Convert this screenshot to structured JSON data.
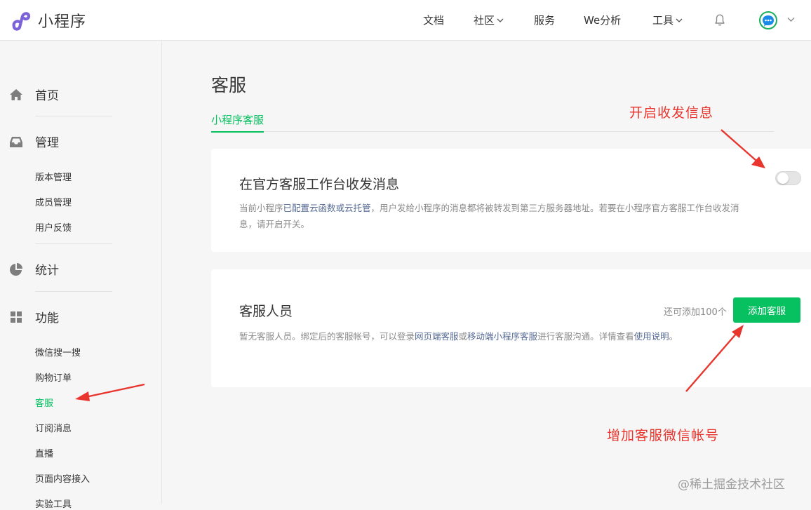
{
  "app": {
    "name": "小程序"
  },
  "nav": [
    {
      "label": "文档",
      "dropdown": false
    },
    {
      "label": "社区",
      "dropdown": true
    },
    {
      "label": "服务",
      "dropdown": false
    },
    {
      "label": "We分析",
      "dropdown": false
    },
    {
      "label": "工具",
      "dropdown": true
    }
  ],
  "header_icons": [
    "bell-icon",
    "chat-avatar-icon",
    "chevron-down-icon"
  ],
  "sidebar": {
    "sections": [
      {
        "label": "首页",
        "icon": "home-icon"
      },
      {
        "label": "管理",
        "icon": "inbox-icon",
        "items": [
          "版本管理",
          "成员管理",
          "用户反馈"
        ]
      },
      {
        "label": "统计",
        "icon": "pie-chart-icon"
      },
      {
        "label": "功能",
        "icon": "grid-icon",
        "items": [
          "微信搜一搜",
          "购物订单",
          "客服",
          "订阅消息",
          "直播",
          "页面内容接入",
          "实验工具"
        ]
      }
    ],
    "active_item": "客服"
  },
  "page": {
    "title": "客服",
    "tabs": [
      "小程序客服"
    ],
    "active_tab": "小程序客服"
  },
  "card_messages": {
    "title": "在官方客服工作台收发消息",
    "desc_prefix": "当前小程序",
    "desc_link": "已配置云函数或云托管",
    "desc_suffix": "，用户发给小程序的消息都将被转发到第三方服务器地址。若要在小程序官方客服工作台收发消",
    "desc_line2": "息，请开启开关。",
    "toggle_on": false
  },
  "card_staff": {
    "title": "客服人员",
    "remaining": "还可添加100个",
    "add_button": "添加客服",
    "desc_prefix": "暂无客服人员。绑定后的客服帐号，可以登录",
    "desc_link1": "网页端客服",
    "desc_mid": "或",
    "desc_link2": "移动端小程序客服",
    "desc_suffix": "进行客服沟通。详情查看",
    "desc_link3": "使用说明",
    "desc_end": "。"
  },
  "annotations": {
    "toggle_note": "开启收发信息",
    "add_note": "增加客服微信帐号"
  },
  "watermark": "@稀土掘金技术社区",
  "colors": {
    "accent": "#07c160",
    "annotation": "#e8352e",
    "link": "#576b95",
    "logo": "#7c62d8"
  }
}
